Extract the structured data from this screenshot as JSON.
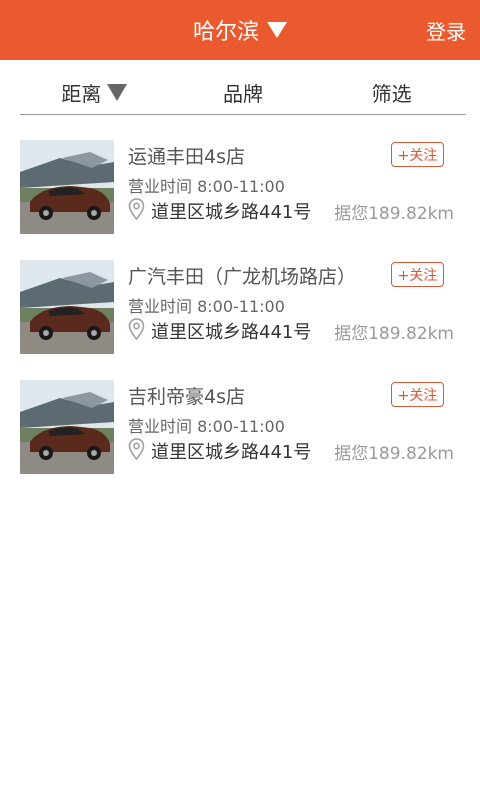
{
  "header": {
    "city": "哈尔滨",
    "login": "登录",
    "background_color": "#ea5a2e"
  },
  "filters": [
    {
      "label": "距离",
      "has_dropdown": true
    },
    {
      "label": "品牌"
    },
    {
      "label": "筛选"
    }
  ],
  "dealers": [
    {
      "name": "运通丰田4s店",
      "follow": "+关注",
      "hours": "营业时间 8:00-11:00",
      "address": "道里区城乡路441号",
      "distance": "据您189.82km",
      "icon": "location-pin-icon"
    },
    {
      "name": "广汽丰田（广龙机场路店）",
      "follow": "+关注",
      "hours": "营业时间 8:00-11:00",
      "address": "道里区城乡路441号",
      "distance": "据您189.82km",
      "icon": "location-pin-icon"
    },
    {
      "name": "吉利帝豪4s店",
      "follow": "+关注",
      "hours": "营业时间 8:00-11:00",
      "address": "道里区城乡路441号",
      "distance": "据您189.82km",
      "icon": "location-pin-icon"
    }
  ]
}
